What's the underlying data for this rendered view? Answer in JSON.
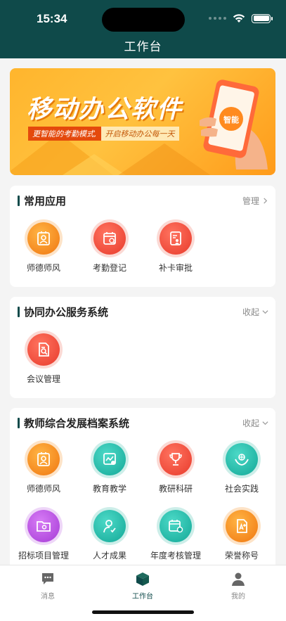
{
  "status_bar": {
    "time": "15:34"
  },
  "header": {
    "title": "工作台"
  },
  "banner": {
    "title": "移动办公软件",
    "subtitle_left": "更智能的考勤模式,",
    "subtitle_right": "开启移动办公每一天",
    "phone_badge": "智能"
  },
  "sections": {
    "common": {
      "title": "常用应用",
      "action": "管理",
      "apps": [
        {
          "label": "师德师风",
          "icon": "portrait-frame-icon",
          "color": "orange"
        },
        {
          "label": "考勤登记",
          "icon": "calendar-check-icon",
          "color": "red"
        },
        {
          "label": "补卡审批",
          "icon": "document-user-icon",
          "color": "red"
        }
      ]
    },
    "collab": {
      "title": "协同办公服务系统",
      "action": "收起",
      "apps": [
        {
          "label": "会议管理",
          "icon": "document-search-icon",
          "color": "red"
        }
      ]
    },
    "archive": {
      "title": "教师综合发展档案系统",
      "action": "收起",
      "apps": [
        {
          "label": "师德师风",
          "icon": "portrait-frame-icon",
          "color": "orange"
        },
        {
          "label": "教育教学",
          "icon": "chart-board-icon",
          "color": "teal"
        },
        {
          "label": "教研科研",
          "icon": "trophy-icon",
          "color": "red"
        },
        {
          "label": "社会实践",
          "icon": "hands-globe-icon",
          "color": "teal"
        },
        {
          "label": "招标项目管理",
          "icon": "folder-gear-icon",
          "color": "purple"
        },
        {
          "label": "人才成果",
          "icon": "person-check-icon",
          "color": "teal"
        },
        {
          "label": "年度考核管理",
          "icon": "calendar-gear-icon",
          "color": "teal"
        },
        {
          "label": "荣誉称号",
          "icon": "certificate-icon",
          "color": "orange"
        }
      ]
    }
  },
  "tabbar": {
    "items": [
      {
        "label": "消息",
        "icon": "message-icon",
        "active": false
      },
      {
        "label": "工作台",
        "icon": "cube-icon",
        "active": true
      },
      {
        "label": "我的",
        "icon": "user-icon",
        "active": false
      }
    ]
  }
}
